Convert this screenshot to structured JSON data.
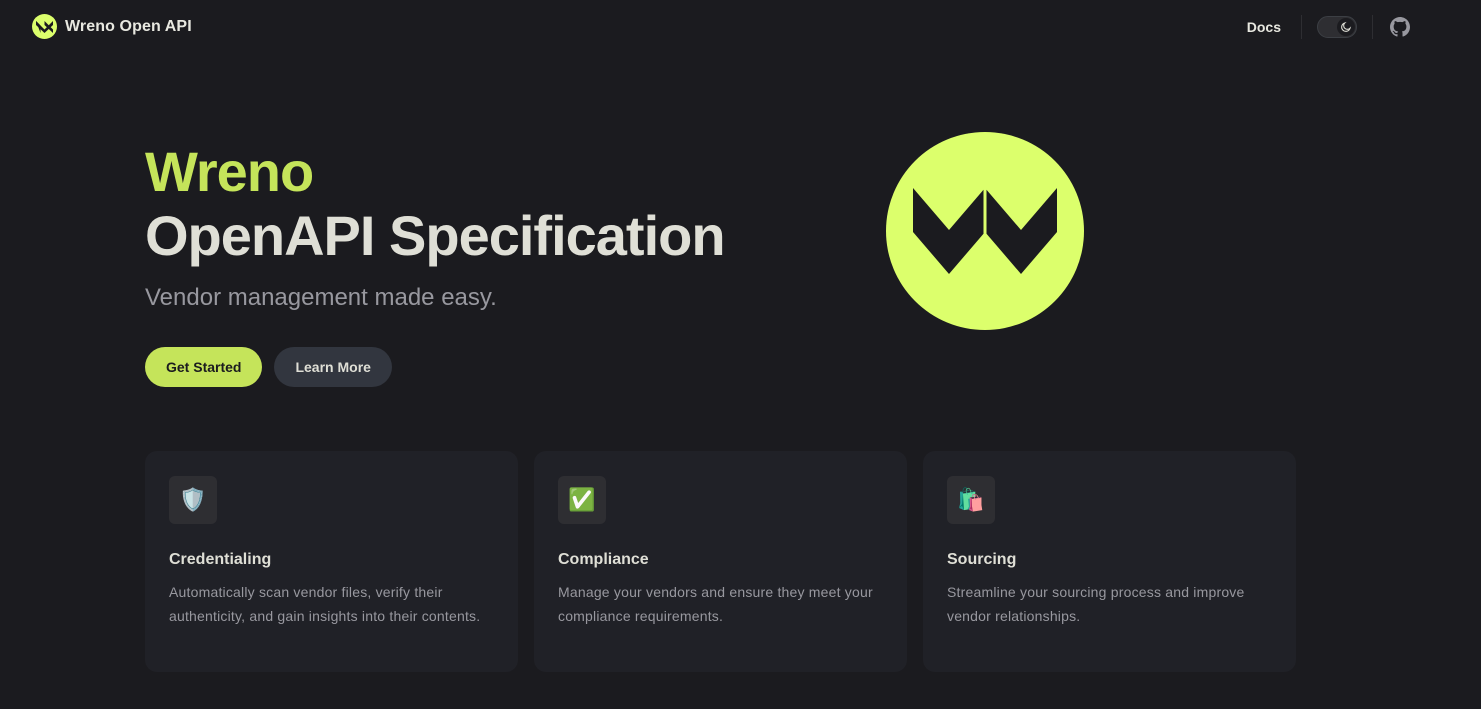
{
  "nav": {
    "title": "Wreno Open API",
    "links": [
      {
        "label": "Docs"
      }
    ],
    "logo_icon": "wreno-logo-icon",
    "appearance_toggle_icon": "moon-icon",
    "social_icon": "github-icon"
  },
  "hero": {
    "name": "Wreno",
    "text": "OpenAPI Specification",
    "tagline": "Vendor management made easy.",
    "actions": [
      {
        "label": "Get Started",
        "theme": "brand"
      },
      {
        "label": "Learn More",
        "theme": "alt"
      }
    ],
    "image_icon": "wreno-logo-icon"
  },
  "features": [
    {
      "icon": "🛡️",
      "icon_name": "shield-icon",
      "title": "Credentialing",
      "details": "Automatically scan vendor files, verify their authenticity, and gain insights into their contents."
    },
    {
      "icon": "✅",
      "icon_name": "check-mark-icon",
      "title": "Compliance",
      "details": "Manage your vendors and ensure they meet your compliance requirements."
    },
    {
      "icon": "🛍️",
      "icon_name": "shopping-bags-icon",
      "title": "Sourcing",
      "details": "Streamline your sourcing process and improve vendor relationships."
    }
  ],
  "colors": {
    "background": "#1b1b1f",
    "brand": "#c5e45a",
    "logo": "#dcff6c",
    "card": "#202127"
  }
}
